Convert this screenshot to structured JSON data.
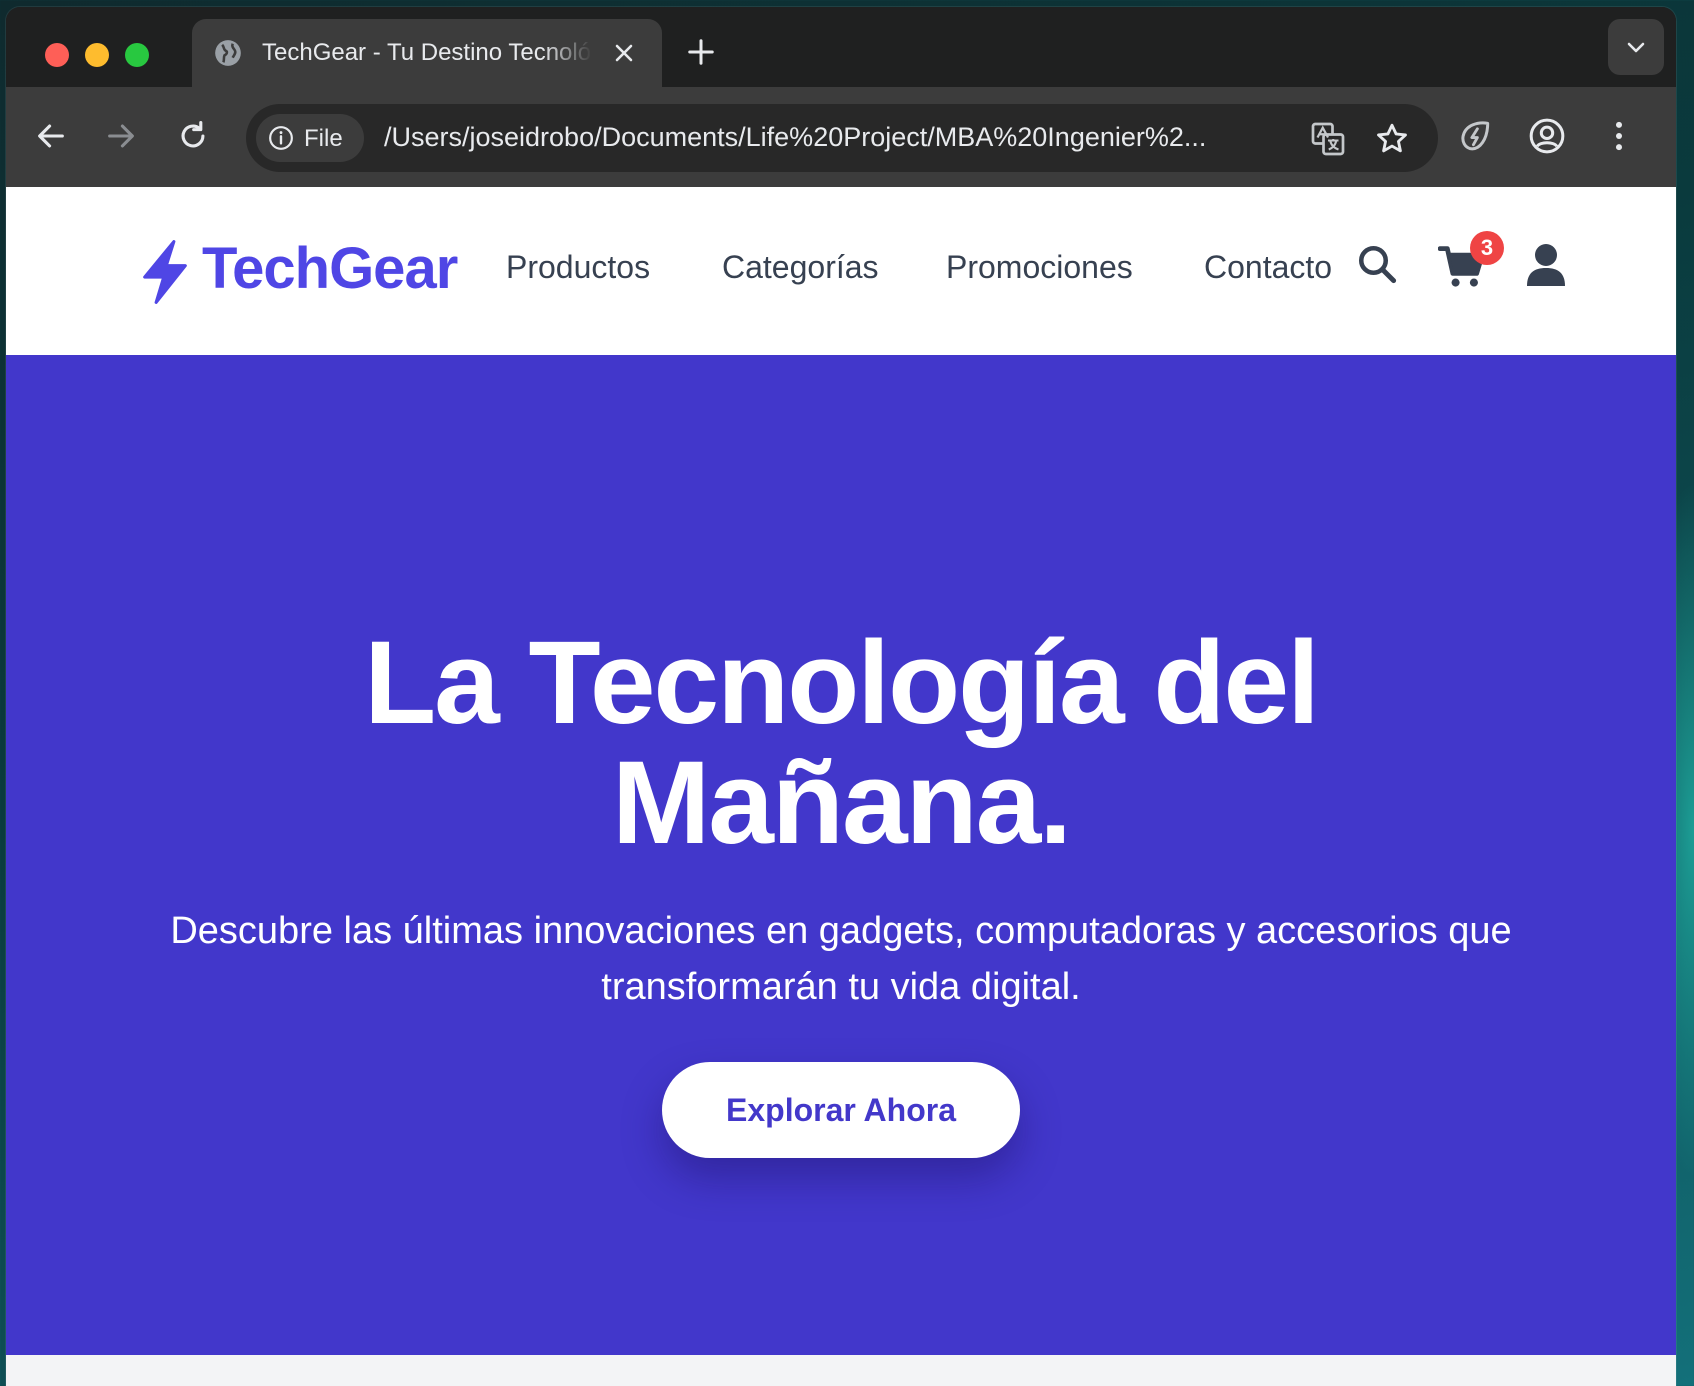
{
  "browser": {
    "tab": {
      "title": "TechGear - Tu Destino Tecnológico"
    },
    "omnibox": {
      "chip_label": "File",
      "url": "/Users/joseidrobo/Documents/Life%20Project/MBA%20Ingenier%2..."
    }
  },
  "site": {
    "logo_text": "TechGear",
    "nav": [
      "Productos",
      "Categorías",
      "Promociones",
      "Contacto"
    ],
    "cart_count": "3",
    "brand_color": "#4f46e5",
    "hero_bg": "#4237cb"
  },
  "hero": {
    "title_line1": "La Tecnología del",
    "title_line2": "Mañana.",
    "subtitle_line1": "Descubre las últimas innovaciones en gadgets, computadoras y accesorios que",
    "subtitle_line2": "transformarán tu vida digital.",
    "cta": "Explorar Ahora"
  }
}
